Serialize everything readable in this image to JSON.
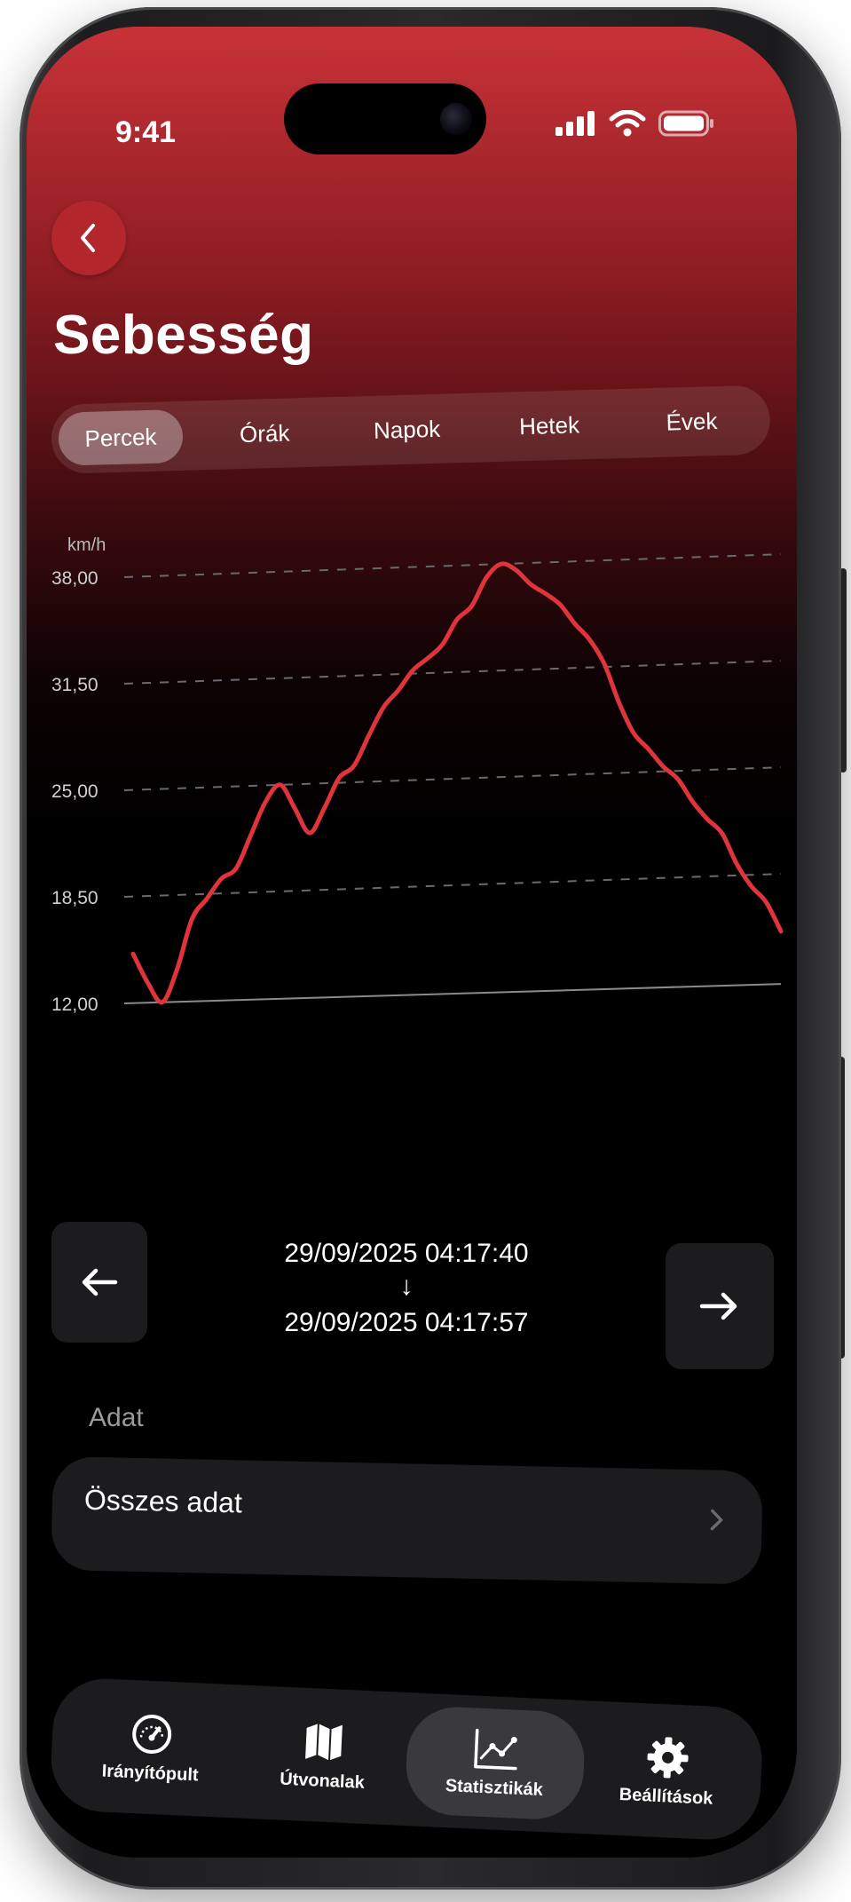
{
  "status_bar": {
    "time": "9:41"
  },
  "header": {
    "back_icon": "chevron-left-icon",
    "title": "Sebesség"
  },
  "period_tabs": [
    {
      "label": "Percek",
      "active": true
    },
    {
      "label": "Órák",
      "active": false
    },
    {
      "label": "Napok",
      "active": false
    },
    {
      "label": "Hetek",
      "active": false
    },
    {
      "label": "Évek",
      "active": false
    }
  ],
  "chart_data": {
    "type": "line",
    "ylabel": "km/h",
    "ylim": [
      12,
      38
    ],
    "y_ticks": [
      "38,00",
      "31,50",
      "25,00",
      "18,50",
      "12,00"
    ],
    "y_tick_values": [
      38,
      31.5,
      25,
      18.5,
      12
    ],
    "grid": "dashed-horizontal",
    "color": "#e0343c",
    "series": [
      {
        "values": [
          15.0,
          13.2,
          12.0,
          14.0,
          17.0,
          18.2,
          19.4,
          20.0,
          22.0,
          24.0,
          25.0,
          23.5,
          22.0,
          23.5,
          25.3,
          26.0,
          27.8,
          29.5,
          30.5,
          31.7,
          32.4,
          33.2,
          34.7,
          35.5,
          37.2,
          38.0,
          37.6,
          36.7,
          36.1,
          35.4,
          34.2,
          33.2,
          31.7,
          29.3,
          27.4,
          26.4,
          25.3,
          24.5,
          23.1,
          22.0,
          21.1,
          19.2,
          17.8,
          16.8,
          15.0
        ]
      }
    ]
  },
  "range": {
    "start": "29/09/2025 04:17:40",
    "arrow": "↓",
    "end": "29/09/2025 04:17:57",
    "prev_icon": "arrow-left-icon",
    "next_icon": "arrow-right-icon"
  },
  "data_section": {
    "label": "Adat",
    "value": "Összes adat",
    "chevron_icon": "chevron-right-icon"
  },
  "tabbar": [
    {
      "label": "Irányítópult",
      "icon": "speedometer-icon",
      "active": false
    },
    {
      "label": "Útvonalak",
      "icon": "map-icon",
      "active": false
    },
    {
      "label": "Statisztikák",
      "icon": "chart-line-icon",
      "active": true
    },
    {
      "label": "Beállítások",
      "icon": "gear-icon",
      "active": false
    }
  ]
}
